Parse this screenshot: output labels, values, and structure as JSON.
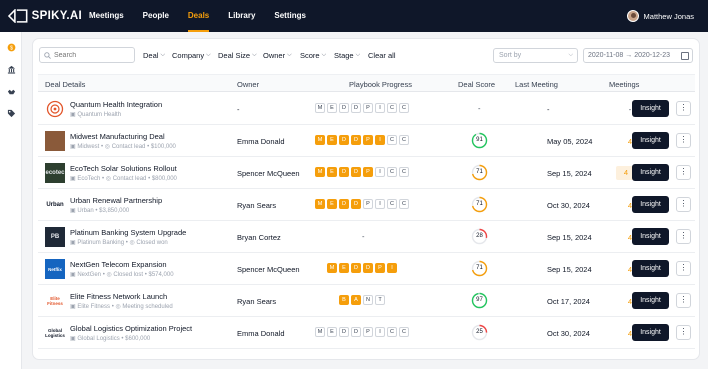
{
  "app": {
    "name": "SPIKY.AI"
  },
  "nav": [
    {
      "label": "Meetings",
      "active": false
    },
    {
      "label": "People",
      "active": false
    },
    {
      "label": "Deals",
      "active": true
    },
    {
      "label": "Library",
      "active": false
    },
    {
      "label": "Settings",
      "active": false
    }
  ],
  "user": {
    "name": "Matthew Jonas"
  },
  "sidebar": {
    "icons": [
      "coin-icon",
      "bank-icon",
      "handshake-icon",
      "tag-icon"
    ]
  },
  "filters": {
    "search_placeholder": "Search",
    "items": [
      "Deal",
      "Company",
      "Deal Size",
      "Owner",
      "Score",
      "Stage"
    ],
    "clear_label": "Clear all",
    "sort_placeholder": "Sort by",
    "date_from": "2020-11-08",
    "date_to": "2020-12-23"
  },
  "table": {
    "headers": [
      "Deal Details",
      "Owner",
      "Playbook Progress",
      "Deal Score",
      "Last Meeting",
      "Meetings"
    ],
    "action_label": "Insight",
    "rows": [
      {
        "title": "Quantum Health Integration",
        "company": "Quantum Health",
        "status": "",
        "amount": "",
        "owner": "-",
        "steps": [
          "M",
          "E",
          "D",
          "D",
          "P",
          "I",
          "C",
          "C"
        ],
        "done": 0,
        "score": null,
        "score_color": "",
        "last_meeting": "-",
        "meetings": "-",
        "highlight": false,
        "logo": {
          "text": "",
          "bg": "#fff",
          "color": "#e2552a"
        }
      },
      {
        "title": "Midwest Manufacturing Deal",
        "company": "Midwest",
        "status": "Contact lead",
        "amount": "$100,000",
        "owner": "Emma Donald",
        "steps": [
          "M",
          "E",
          "D",
          "D",
          "P",
          "I",
          "C",
          "C"
        ],
        "done": 6,
        "score": 91,
        "score_color": "#22c55e",
        "last_meeting": "May 05, 2024",
        "meetings": "4",
        "highlight": false,
        "logo": {
          "text": "",
          "bg": "#8a5a3a",
          "color": "#fff"
        }
      },
      {
        "title": "EcoTech Solar Solutions Rollout",
        "company": "EcoTech",
        "status": "Contact lead",
        "amount": "$800,000",
        "owner": "Spencer McQueen",
        "steps": [
          "M",
          "E",
          "D",
          "D",
          "P",
          "I",
          "C",
          "C"
        ],
        "done": 5,
        "score": 71,
        "score_color": "#f59e0b",
        "last_meeting": "Sep 15, 2024",
        "meetings": "4",
        "highlight": true,
        "logo": {
          "text": "ecotec",
          "bg": "#2d3f2f",
          "color": "#e5e7eb"
        }
      },
      {
        "title": "Urban Renewal Partnership",
        "company": "Urban",
        "status": "",
        "amount": "$3,850,000",
        "owner": "Ryan Sears",
        "steps": [
          "M",
          "E",
          "D",
          "D",
          "P",
          "I",
          "C",
          "C"
        ],
        "done": 4,
        "score": 71,
        "score_color": "#f59e0b",
        "last_meeting": "Oct 30, 2024",
        "meetings": "4",
        "highlight": false,
        "logo": {
          "text": "Urban",
          "bg": "#fff",
          "color": "#111827"
        }
      },
      {
        "title": "Platinum Banking System Upgrade",
        "company": "Platinum Banking",
        "status": "Closed won",
        "amount": "",
        "owner": "Bryan Cortez",
        "steps": [],
        "done": 0,
        "score": 28,
        "score_color": "#ef4444",
        "last_meeting": "Sep 15, 2024",
        "meetings": "4",
        "highlight": false,
        "logo": {
          "text": "PB",
          "bg": "#1f2937",
          "color": "#e5e7eb"
        }
      },
      {
        "title": "NextGen Telecom Expansion",
        "company": "NextGen",
        "status": "Closed lost",
        "amount": "$574,000",
        "owner": "Spencer McQueen",
        "steps": [
          "M",
          "E",
          "D",
          "D",
          "P",
          "I"
        ],
        "done": 6,
        "score": 71,
        "score_color": "#f59e0b",
        "last_meeting": "Sep 15, 2024",
        "meetings": "4",
        "highlight": false,
        "logo": {
          "text": "Netflix",
          "bg": "#1565c0",
          "color": "#fff"
        }
      },
      {
        "title": "Elite Fitness Network Launch",
        "company": "Elite Fitness",
        "status": "Meeting scheduled",
        "amount": "",
        "owner": "Ryan Sears",
        "steps": [
          "B",
          "A",
          "N",
          "T"
        ],
        "done": 2,
        "score": 97,
        "score_color": "#22c55e",
        "last_meeting": "Oct 17, 2024",
        "meetings": "4",
        "highlight": false,
        "logo": {
          "text": "Elite Fitness",
          "bg": "#fff",
          "color": "#e2552a"
        }
      },
      {
        "title": "Global Logistics Optimization Project",
        "company": "Global Logistics",
        "status": "",
        "amount": "$600,000",
        "owner": "Emma Donald",
        "steps": [
          "M",
          "E",
          "D",
          "D",
          "P",
          "I",
          "C",
          "C"
        ],
        "done": 0,
        "score": 25,
        "score_color": "#ef4444",
        "last_meeting": "Oct 30, 2024",
        "meetings": "4",
        "highlight": false,
        "logo": {
          "text": "Global Logistics",
          "bg": "#fff",
          "color": "#111827"
        }
      }
    ]
  }
}
